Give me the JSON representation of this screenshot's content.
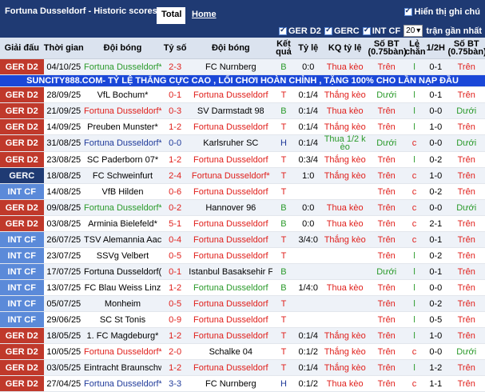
{
  "header": {
    "title": "Fortuna Dusseldorf - Historic scores",
    "tab_total": "Total",
    "tab_home": "Home",
    "note_label": "Hiển thị ghi chú"
  },
  "filters": {
    "items": [
      "GER D2",
      "GERC",
      "INT CF"
    ],
    "count_value": "20",
    "count_suffix": "trận gần nhất"
  },
  "columns": [
    "Giải đấu",
    "Thời gian",
    "Đội bóng",
    "Tỷ số",
    "Đội bóng",
    "Kết quả",
    "Tỷ lệ",
    "KQ tỷ lệ",
    "Số BT (0.75bàn)",
    "Lẻ chẵn",
    "1/2H",
    "Số BT (0.75bàn)"
  ],
  "ad_text": "SUNCITY888.COM- TỶ LỆ THẮNG CỰC CAO , LỐI CHƠI HOÀN CHỈNH , TẶNG 100% CHO LẦN NẠP ĐẦU",
  "rows": [
    {
      "league": "GER D2",
      "lc": "ger",
      "date": "04/10/25",
      "home": "Fortuna Dusseldorf*",
      "hc": "green",
      "score": "2-3",
      "sc": "red",
      "away": "FC Nurnberg",
      "ac": "",
      "res": "B",
      "rc": "green",
      "odds": "0:0",
      "oc": "",
      "ko": "Thua kèo",
      "kc": "red",
      "ou": "Trên",
      "ouc": "red",
      "eo": "l",
      "eoc": "green",
      "half": "0-1",
      "fou": "Trên",
      "fouc": "red"
    },
    {
      "ad": true
    },
    {
      "league": "GER D2",
      "lc": "ger",
      "date": "28/09/25",
      "home": "VfL Bochum*",
      "hc": "",
      "score": "0-1",
      "sc": "red",
      "away": "Fortuna Dusseldorf",
      "ac": "red",
      "res": "T",
      "rc": "red",
      "odds": "0:1/4",
      "oc": "",
      "ko": "Thắng kèo",
      "kc": "red",
      "ou": "Dưới",
      "ouc": "green",
      "eo": "l",
      "eoc": "green",
      "half": "0-1",
      "fou": "Trên",
      "fouc": "red"
    },
    {
      "league": "GER D2",
      "lc": "ger",
      "date": "21/09/25",
      "home": "Fortuna Dusseldorf*",
      "hc": "red",
      "score": "0-3",
      "sc": "red",
      "away": "SV Darmstadt 98",
      "ac": "",
      "res": "B",
      "rc": "green",
      "odds": "0:1/4",
      "oc": "",
      "ko": "Thua kèo",
      "kc": "red",
      "ou": "Trên",
      "ouc": "red",
      "eo": "l",
      "eoc": "green",
      "half": "0-0",
      "fou": "Dưới",
      "fouc": "green"
    },
    {
      "league": "GER D2",
      "lc": "ger",
      "date": "14/09/25",
      "home": "Preuben Munster*",
      "hc": "",
      "score": "1-2",
      "sc": "red",
      "away": "Fortuna Dusseldorf",
      "ac": "red",
      "res": "T",
      "rc": "red",
      "odds": "0:1/4",
      "oc": "",
      "ko": "Thắng kèo",
      "kc": "red",
      "ou": "Trên",
      "ouc": "red",
      "eo": "l",
      "eoc": "green",
      "half": "1-0",
      "fou": "Trên",
      "fouc": "red"
    },
    {
      "league": "GER D2",
      "lc": "ger",
      "date": "31/08/25",
      "home": "Fortuna Dusseldorf*",
      "hc": "blue",
      "score": "0-0",
      "sc": "blue",
      "away": "Karlsruher SC",
      "ac": "",
      "res": "H",
      "rc": "blue",
      "odds": "0:1/4",
      "oc": "",
      "ko": "Thua 1/2 k èo",
      "kc": "green",
      "ou": "Dưới",
      "ouc": "green",
      "eo": "c",
      "eoc": "red",
      "half": "0-0",
      "fou": "Dưới",
      "fouc": "green"
    },
    {
      "league": "GER D2",
      "lc": "ger",
      "date": "23/08/25",
      "home": "SC Paderborn 07*",
      "hc": "",
      "score": "1-2",
      "sc": "red",
      "away": "Fortuna Dusseldorf",
      "ac": "red",
      "res": "T",
      "rc": "red",
      "odds": "0:3/4",
      "oc": "",
      "ko": "Thắng kèo",
      "kc": "red",
      "ou": "Trên",
      "ouc": "red",
      "eo": "l",
      "eoc": "green",
      "half": "0-2",
      "fou": "Trên",
      "fouc": "red"
    },
    {
      "league": "GERC",
      "lc": "gerc",
      "date": "18/08/25",
      "home": "FC Schweinfurt",
      "hc": "",
      "score": "2-4",
      "sc": "red",
      "away": "Fortuna Dusseldorf*",
      "ac": "red",
      "res": "T",
      "rc": "red",
      "odds": "1:0",
      "oc": "",
      "ko": "Thắng kèo",
      "kc": "red",
      "ou": "Trên",
      "ouc": "red",
      "eo": "c",
      "eoc": "red",
      "half": "1-0",
      "fou": "Trên",
      "fouc": "red"
    },
    {
      "league": "INT CF",
      "lc": "intcf",
      "date": "14/08/25",
      "home": "VfB Hilden",
      "hc": "",
      "score": "0-6",
      "sc": "red",
      "away": "Fortuna Dusseldorf",
      "ac": "red",
      "res": "T",
      "rc": "red",
      "odds": "",
      "oc": "",
      "ko": "",
      "kc": "",
      "ou": "Trên",
      "ouc": "red",
      "eo": "c",
      "eoc": "red",
      "half": "0-2",
      "fou": "Trên",
      "fouc": "red"
    },
    {
      "league": "GER D2",
      "lc": "ger",
      "date": "09/08/25",
      "home": "Fortuna Dusseldorf*",
      "hc": "green",
      "score": "0-2",
      "sc": "red",
      "away": "Hannover 96",
      "ac": "",
      "res": "B",
      "rc": "green",
      "odds": "0:0",
      "oc": "",
      "ko": "Thua kèo",
      "kc": "red",
      "ou": "Trên",
      "ouc": "red",
      "eo": "c",
      "eoc": "red",
      "half": "0-0",
      "fou": "Dưới",
      "fouc": "green"
    },
    {
      "league": "GER D2",
      "lc": "ger",
      "date": "03/08/25",
      "home": "Arminia Bielefeld*",
      "hc": "",
      "score": "5-1",
      "sc": "red",
      "away": "Fortuna Dusseldorf",
      "ac": "red",
      "res": "B",
      "rc": "green",
      "odds": "0:0",
      "oc": "",
      "ko": "Thua kèo",
      "kc": "red",
      "ou": "Trên",
      "ouc": "red",
      "eo": "c",
      "eoc": "red",
      "half": "2-1",
      "fou": "Trên",
      "fouc": "red"
    },
    {
      "league": "INT CF",
      "lc": "intcf",
      "date": "26/07/25",
      "home": "TSV Alemannia Aachen",
      "hc": "",
      "score": "0-4",
      "sc": "red",
      "away": "Fortuna Dusseldorf",
      "ac": "red",
      "res": "T",
      "rc": "red",
      "odds": "3/4:0",
      "oc": "",
      "ko": "Thắng kèo",
      "kc": "red",
      "ou": "Trên",
      "ouc": "red",
      "eo": "c",
      "eoc": "red",
      "half": "0-1",
      "fou": "Trên",
      "fouc": "red"
    },
    {
      "league": "INT CF",
      "lc": "intcf",
      "date": "23/07/25",
      "home": "SSVg Velbert",
      "hc": "",
      "score": "0-5",
      "sc": "red",
      "away": "Fortuna Dusseldorf",
      "ac": "red",
      "res": "T",
      "rc": "red",
      "odds": "",
      "oc": "",
      "ko": "",
      "kc": "",
      "ou": "Trên",
      "ouc": "red",
      "eo": "l",
      "eoc": "green",
      "half": "0-2",
      "fou": "Trên",
      "fouc": "red"
    },
    {
      "league": "INT CF",
      "lc": "intcf",
      "date": "17/07/25",
      "home": "Fortuna Dusseldorf(T)",
      "hc": "",
      "score": "0-1",
      "sc": "red",
      "away": "Istanbul Basaksehir F. K.",
      "ac": "",
      "res": "B",
      "rc": "green",
      "odds": "",
      "oc": "",
      "ko": "",
      "kc": "",
      "ou": "Dưới",
      "ouc": "green",
      "eo": "l",
      "eoc": "green",
      "half": "0-1",
      "fou": "Trên",
      "fouc": "red"
    },
    {
      "league": "INT CF",
      "lc": "intcf",
      "date": "13/07/25",
      "home": "FC Blau Weiss Linz",
      "hc": "",
      "score": "1-2",
      "sc": "red",
      "away": "Fortuna Dusseldorf",
      "ac": "green",
      "res": "B",
      "rc": "green",
      "odds": "1/4:0",
      "oc": "",
      "ko": "Thua kèo",
      "kc": "red",
      "ou": "Trên",
      "ouc": "red",
      "eo": "l",
      "eoc": "green",
      "half": "0-0",
      "fou": "Trên",
      "fouc": "red"
    },
    {
      "league": "INT CF",
      "lc": "intcf",
      "date": "05/07/25",
      "home": "Monheim",
      "hc": "",
      "score": "0-5",
      "sc": "red",
      "away": "Fortuna Dusseldorf",
      "ac": "red",
      "res": "T",
      "rc": "red",
      "odds": "",
      "oc": "",
      "ko": "",
      "kc": "",
      "ou": "Trên",
      "ouc": "red",
      "eo": "l",
      "eoc": "green",
      "half": "0-2",
      "fou": "Trên",
      "fouc": "red"
    },
    {
      "league": "INT CF",
      "lc": "intcf",
      "date": "29/06/25",
      "home": "SC St Tonis",
      "hc": "",
      "score": "0-9",
      "sc": "red",
      "away": "Fortuna Dusseldorf",
      "ac": "red",
      "res": "T",
      "rc": "red",
      "odds": "",
      "oc": "",
      "ko": "",
      "kc": "",
      "ou": "Trên",
      "ouc": "red",
      "eo": "l",
      "eoc": "green",
      "half": "0-5",
      "fou": "Trên",
      "fouc": "red"
    },
    {
      "league": "GER D2",
      "lc": "ger",
      "date": "18/05/25",
      "home": "1. FC Magdeburg*",
      "hc": "",
      "score": "1-2",
      "sc": "red",
      "away": "Fortuna Dusseldorf",
      "ac": "red",
      "res": "T",
      "rc": "red",
      "odds": "0:1/4",
      "oc": "",
      "ko": "Thắng kèo",
      "kc": "red",
      "ou": "Trên",
      "ouc": "red",
      "eo": "l",
      "eoc": "green",
      "half": "1-0",
      "fou": "Trên",
      "fouc": "red"
    },
    {
      "league": "GER D2",
      "lc": "ger",
      "date": "10/05/25",
      "home": "Fortuna Dusseldorf*",
      "hc": "red",
      "score": "2-0",
      "sc": "red",
      "away": "Schalke 04",
      "ac": "",
      "res": "T",
      "rc": "red",
      "odds": "0:1/2",
      "oc": "",
      "ko": "Thắng kèo",
      "kc": "red",
      "ou": "Trên",
      "ouc": "red",
      "eo": "c",
      "eoc": "red",
      "half": "0-0",
      "fou": "Dưới",
      "fouc": "green"
    },
    {
      "league": "GER D2",
      "lc": "ger",
      "date": "03/05/25",
      "home": "Eintracht Braunschweig",
      "hc": "",
      "score": "1-2",
      "sc": "red",
      "away": "Fortuna Dusseldorf",
      "ac": "red",
      "res": "T",
      "rc": "red",
      "odds": "0:1/4",
      "oc": "",
      "ko": "Thắng kèo",
      "kc": "red",
      "ou": "Trên",
      "ouc": "red",
      "eo": "l",
      "eoc": "green",
      "half": "1-2",
      "fou": "Trên",
      "fouc": "red"
    },
    {
      "league": "GER D2",
      "lc": "ger",
      "date": "27/04/25",
      "home": "Fortuna Dusseldorf*",
      "hc": "blue",
      "score": "3-3",
      "sc": "blue",
      "away": "FC Nurnberg",
      "ac": "",
      "res": "H",
      "rc": "blue",
      "odds": "0:1/2",
      "oc": "",
      "ko": "Thua kèo",
      "kc": "red",
      "ou": "Trên",
      "ouc": "red",
      "eo": "c",
      "eoc": "red",
      "half": "1-1",
      "fou": "Trên",
      "fouc": "red"
    }
  ]
}
